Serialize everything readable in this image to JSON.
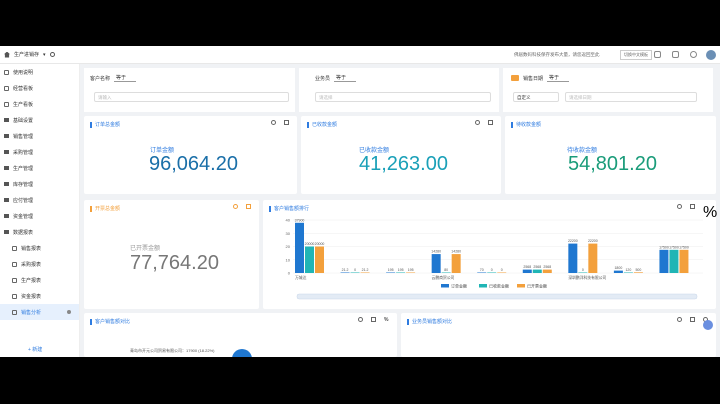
{
  "topbar": {
    "brand": "生产进销存",
    "notice": "佛居数码科技保存发布大量，请您返回至此",
    "lang": "切换中文模板"
  },
  "sidebar": {
    "items": [
      {
        "label": "使用说明",
        "type": "page"
      },
      {
        "label": "经营看板",
        "type": "page"
      },
      {
        "label": "生产看板",
        "type": "page"
      },
      {
        "label": "基础设置",
        "type": "folder"
      },
      {
        "label": "销售管理",
        "type": "folder"
      },
      {
        "label": "采购管理",
        "type": "folder"
      },
      {
        "label": "生产管理",
        "type": "folder"
      },
      {
        "label": "库存管理",
        "type": "folder"
      },
      {
        "label": "应付管理",
        "type": "folder"
      },
      {
        "label": "资金管理",
        "type": "folder"
      },
      {
        "label": "数据报表",
        "type": "folder"
      },
      {
        "label": "销售报表",
        "type": "sub"
      },
      {
        "label": "采购报表",
        "type": "sub"
      },
      {
        "label": "生产报表",
        "type": "sub"
      },
      {
        "label": "资金报表",
        "type": "sub"
      },
      {
        "label": "销售分析",
        "type": "sub",
        "active": true
      }
    ],
    "new_label": "+ 新建"
  },
  "filters": {
    "customer": {
      "label": "客户名称",
      "op": "等于",
      "placeholder": "请输入"
    },
    "salesman": {
      "label": "业务员",
      "op": "等于",
      "placeholder": "请选择"
    },
    "date": {
      "label": "销售日期",
      "op": "等于",
      "mode": "自定义",
      "placeholder": "请选择日期"
    }
  },
  "metrics": {
    "order": {
      "title": "订单总金额",
      "label": "订单金额",
      "value": "96,064.20"
    },
    "received": {
      "title": "已收款金额",
      "label": "已收款金额",
      "value": "41,263.00"
    },
    "pending": {
      "title": "待收款金额",
      "label": "待收款金额",
      "value": "54,801.20"
    },
    "invoiced": {
      "title": "开票总金额",
      "label": "已开票金额",
      "value": "77,764.20"
    }
  },
  "ranking_card": {
    "title": "客户销售额排行"
  },
  "bottom_cards": {
    "left": {
      "title": "客户销售额对比",
      "legend_text": "青岛市开元公司贸易有限公司：17900 (18.22%)"
    },
    "right": {
      "title": "业务员销售额对比"
    }
  },
  "chart_data": {
    "type": "bar",
    "ylim": [
      0,
      40
    ],
    "yticks": [
      0,
      10,
      20,
      30,
      40
    ],
    "categories": [
      "万城达",
      "",
      "",
      "",
      "",
      "",
      "云鹏商贸公司",
      "",
      "",
      "",
      "深圳鹏洋科技有限公司",
      "",
      "",
      ""
    ],
    "series": [
      {
        "name": "订单金额",
        "color": "#1f77d0",
        "values": [
          37900,
          21.2,
          195,
          14280,
          70,
          2568,
          22200,
          1800,
          17500
        ]
      },
      {
        "name": "已收款金额",
        "color": "#20b5b5",
        "values": [
          20000,
          0,
          195,
          80,
          0,
          2568,
          0,
          120,
          17500
        ]
      },
      {
        "name": "已开票金额",
        "color": "#f3a03c",
        "values": [
          20000,
          21.2,
          195,
          14280,
          0,
          2568,
          22200,
          500,
          17500
        ]
      }
    ],
    "group_labels": [
      [
        "37900",
        "20000",
        "20000"
      ],
      [
        "21.2",
        "0",
        "21.2"
      ],
      [
        "195",
        "195",
        "195"
      ],
      [
        "14280",
        "80",
        "14280"
      ],
      [
        "70",
        "0",
        "0"
      ],
      [
        "2568",
        "2568",
        "2568"
      ],
      [
        "22200",
        "0",
        "22200"
      ],
      [
        "1800",
        "120",
        "500"
      ],
      [
        "17500",
        "17500",
        "17500"
      ]
    ],
    "x_labels": [
      "万城达",
      "云鹏商贸公司",
      "深圳鹏洋科技有限公司"
    ],
    "legend_position": "bottom"
  }
}
